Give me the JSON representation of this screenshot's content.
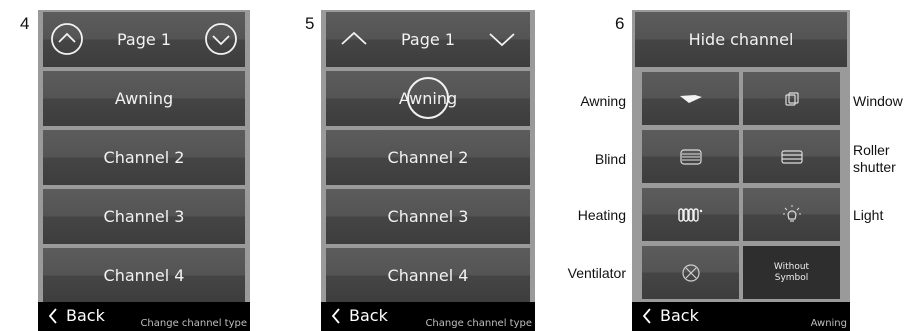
{
  "steps": [
    "4",
    "5",
    "6"
  ],
  "screen4": {
    "page_title": "Page 1",
    "channels": [
      "Awning",
      "Channel 2",
      "Channel 3",
      "Channel 4"
    ],
    "back_label": "Back",
    "subtitle": "Change channel type"
  },
  "screen5": {
    "page_title": "Page 1",
    "channels": [
      "Awning",
      "Channel 2",
      "Channel 3",
      "Channel 4"
    ],
    "back_label": "Back",
    "subtitle": "Change channel type"
  },
  "screen6": {
    "header": "Hide channel",
    "types": [
      {
        "label": "Awning",
        "icon": "awning-icon"
      },
      {
        "label": "Window",
        "icon": "window-icon"
      },
      {
        "label": "Blind",
        "icon": "blind-icon"
      },
      {
        "label": "Roller shutter",
        "icon": "roller-shutter-icon"
      },
      {
        "label": "Heating",
        "icon": "heating-icon"
      },
      {
        "label": "Light",
        "icon": "light-icon"
      },
      {
        "label": "Ventilator",
        "icon": "ventilator-icon"
      },
      {
        "label": "Without Symbol",
        "icon": ""
      }
    ],
    "back_label": "Back",
    "subtitle": "Awning"
  }
}
